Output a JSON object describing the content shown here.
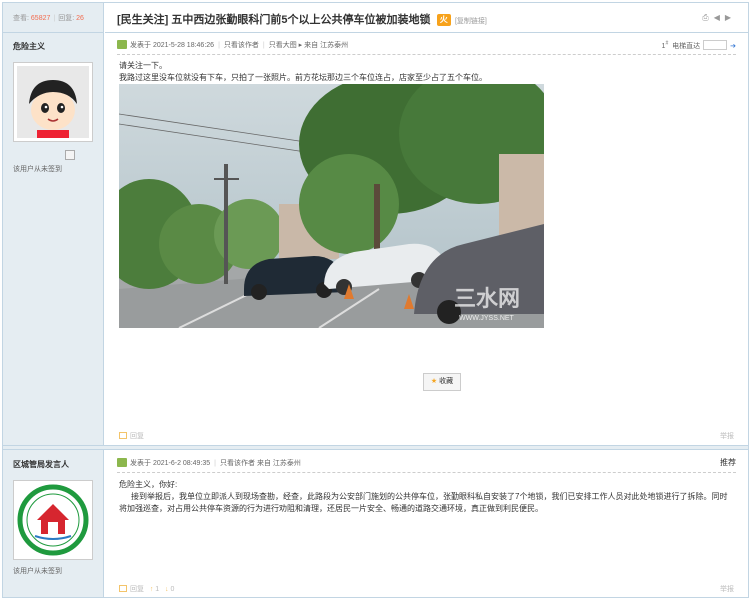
{
  "header": {
    "views_label": "查看:",
    "views": "65827",
    "replies_label": "回复:",
    "replies": "26",
    "title": "[民生关注] 五中西边张勤眼科门前5个以上公共停车位被加装地锁",
    "hot_icon": "火",
    "copy_link": "[复制链接]"
  },
  "post1": {
    "author": "危险主义",
    "sign_note": "该用户从未签到",
    "posted": "发表于 2021-5-28 18:46:26",
    "only_author": "只看该作者",
    "big_image": "只看大图",
    "source": "来自 江苏泰州",
    "floor": "1",
    "floor_sup": "#",
    "jump_label": "电梯直达",
    "lines": [
      "请关注一下。",
      "我路过这里没车位就没有下车，只拍了一张照片。前方花坛那边三个车位连占，店家至少占了五个车位。"
    ],
    "watermark": "三水网",
    "watermark_url": "WWW.JYSS.NET",
    "favorite": "收藏",
    "reply": "回复",
    "report": "举报"
  },
  "post2": {
    "author": "区城管局发言人",
    "sign_note": "该用户从未签到",
    "posted": "发表于 2021-6-2 08:49:35",
    "only_author": "只看该作者",
    "source": "来自 江苏泰州",
    "recommend": "推荐",
    "greeting": "危险主义，你好:",
    "body": "接到举报后，我单位立即派人到现场查勘，经查，此路段为公安部门施划的公共停车位，张勤眼科私自安装了7个地锁，我们已安排工作人员对此处地锁进行了拆除。同时将加强巡查，对占用公共停车资源的行为进行劝阻和清理，还居民一片安全、畅通的道路交通环境，真正做到利民便民。",
    "reply": "回复",
    "up": "1",
    "down": "0",
    "report": "举报"
  },
  "colors": {
    "accent": "#f26c4f",
    "border": "#c2d5e3",
    "sidebar": "#e5edf2"
  }
}
